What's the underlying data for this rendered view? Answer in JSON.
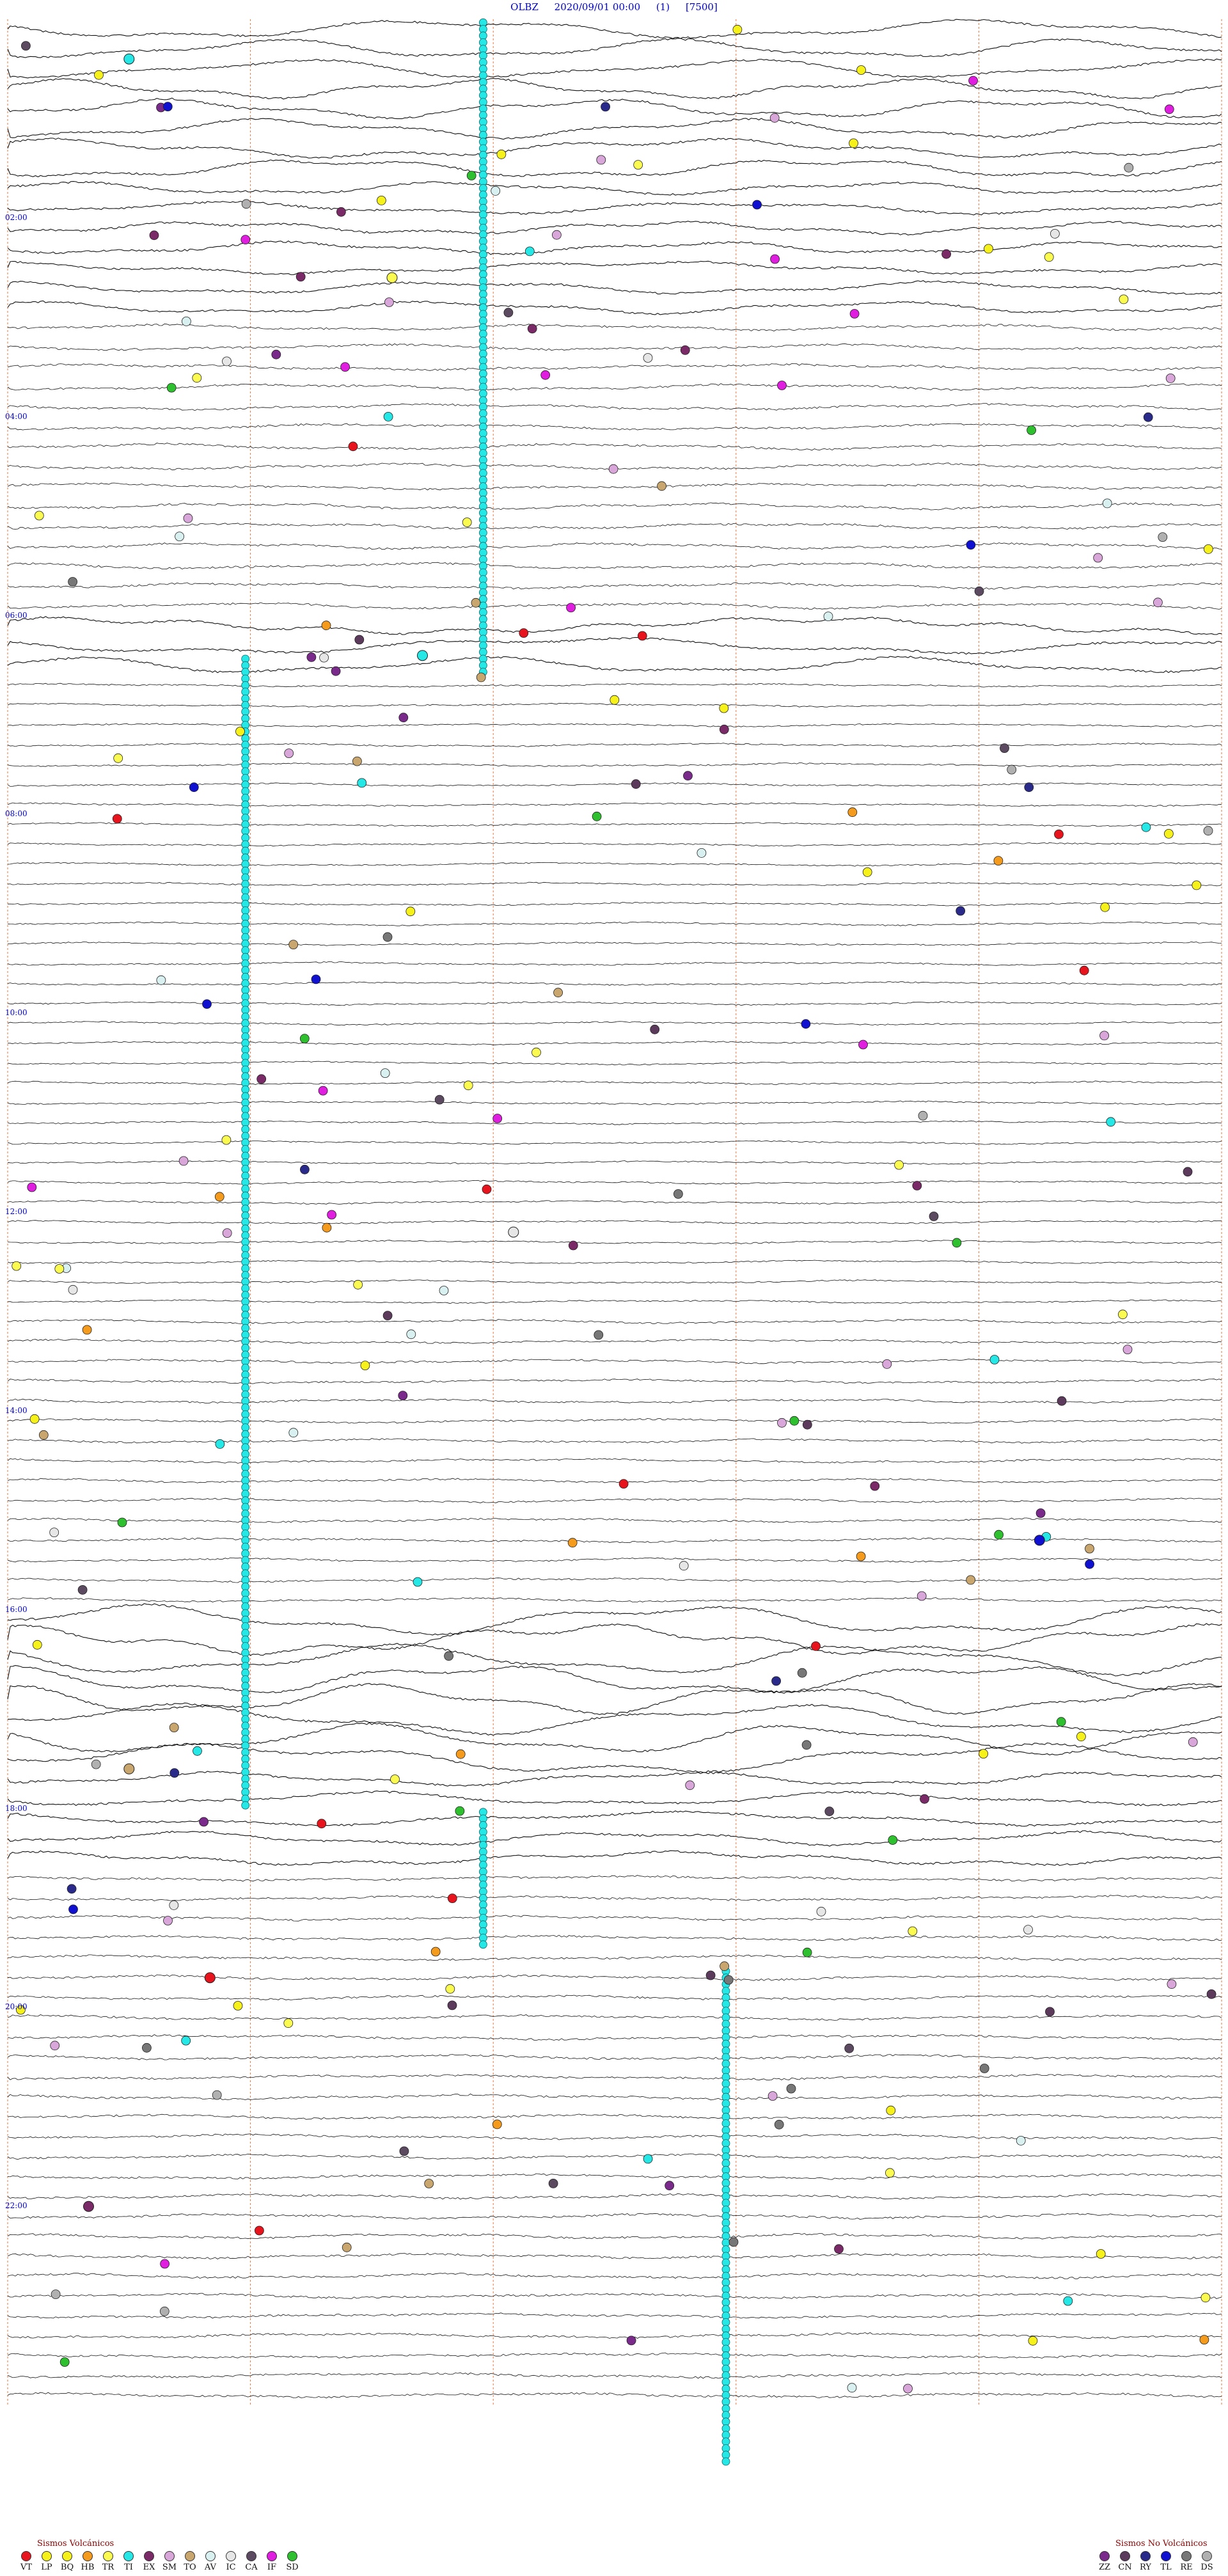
{
  "header": {
    "station": "OLBZ",
    "datetime": "2020/09/01 00:00",
    "channel": "(1)",
    "scale": "[7500]"
  },
  "hour_labels": [
    "02:00",
    "04:00",
    "06:00",
    "08:00",
    "10:00",
    "12:00",
    "14:00",
    "16:00",
    "18:00",
    "20:00",
    "22:00"
  ],
  "legend_volcanic": {
    "title": "Sismos Volcánicos",
    "items": [
      {
        "code": "VT",
        "color": "#e8141d"
      },
      {
        "code": "LP",
        "color": "#f6f11b"
      },
      {
        "code": "BQ",
        "color": "#f6f11b"
      },
      {
        "code": "HB",
        "color": "#f49a1c"
      },
      {
        "code": "TR",
        "color": "#fafa50"
      },
      {
        "code": "TI",
        "color": "#25e8e6"
      },
      {
        "code": "EX",
        "color": "#7a2a66"
      },
      {
        "code": "SM",
        "color": "#d9a6d9"
      },
      {
        "code": "TO",
        "color": "#c8a66e"
      },
      {
        "code": "AV",
        "color": "#d9f0f0"
      },
      {
        "code": "IC",
        "color": "#e6e6e6"
      },
      {
        "code": "CA",
        "color": "#5c4a60"
      },
      {
        "code": "IF",
        "color": "#e01ee0"
      },
      {
        "code": "SD",
        "color": "#2ec02e"
      }
    ]
  },
  "legend_nonvolcanic": {
    "title": "Sismos No Volcánicos",
    "items": [
      {
        "code": "ZZ",
        "color": "#7a2a8a"
      },
      {
        "code": "CN",
        "color": "#5c3a5c"
      },
      {
        "code": "RY",
        "color": "#2a2a8a"
      },
      {
        "code": "TL",
        "color": "#1010d0"
      },
      {
        "code": "RE",
        "color": "#777777"
      },
      {
        "code": "DS",
        "color": "#b0b0b0"
      }
    ]
  },
  "chart_data": {
    "type": "helicorder",
    "station": "OLBZ",
    "start": "2020-09-01 00:00",
    "duration_hours": 24,
    "traces_per_hour": 5,
    "minutes_per_trace": 12,
    "markers": [
      {
        "hour": 0.3,
        "minute": 1.2,
        "type": "TI"
      },
      {
        "hour": 2.5,
        "minute": 3.8,
        "type": "TR"
      },
      {
        "hour": 6.3,
        "minute": 4.1,
        "type": "TI"
      },
      {
        "hour": 12.1,
        "minute": 5.0,
        "type": "IC"
      },
      {
        "hour": 15.2,
        "minute": 10.2,
        "type": "TL"
      },
      {
        "hour": 17.5,
        "minute": 1.2,
        "type": "TO"
      },
      {
        "hour": 19.6,
        "minute": 2.0,
        "type": "VT"
      },
      {
        "hour": 21.9,
        "minute": 0.8,
        "type": "EX"
      }
    ]
  }
}
